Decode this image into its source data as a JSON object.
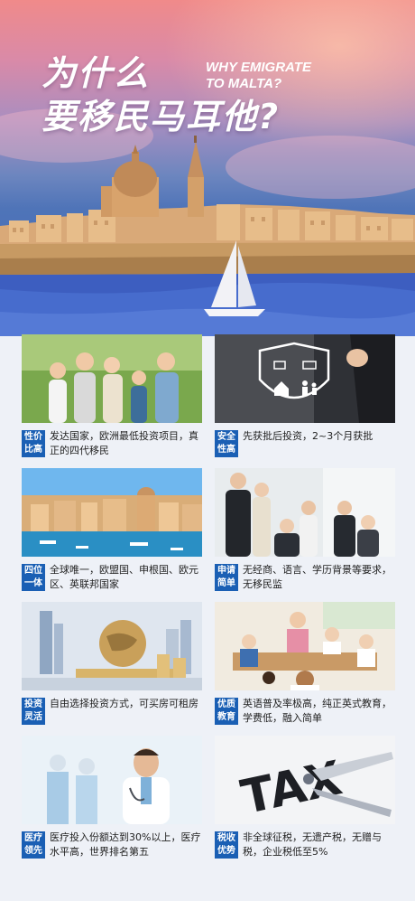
{
  "hero": {
    "title_line1": "为什么",
    "title_line2": "要移民马耳他?",
    "en_line1": "WHY EMIGRATE",
    "en_line2": "TO MALTA?"
  },
  "cards": [
    {
      "tag": [
        "性价",
        "比高"
      ],
      "text": "发达国家，欧洲最低投资项目，真正的四代移民",
      "photo": "family-photo"
    },
    {
      "tag": [
        "安全",
        "性高"
      ],
      "text": "先获批后投资，2~3个月获批",
      "photo": "security-shield-photo"
    },
    {
      "tag": [
        "四位",
        "一体"
      ],
      "text": "全球唯一，欧盟国、申根国、欧元区、英联邦国家",
      "photo": "malta-harbor-photo"
    },
    {
      "tag": [
        "申请",
        "简单"
      ],
      "text": "无经商、语言、学历背景等要求，无移民监",
      "photo": "business-team-photo"
    },
    {
      "tag": [
        "投资",
        "灵活"
      ],
      "text": "自由选择投资方式，可买房可租房",
      "photo": "globe-coins-photo"
    },
    {
      "tag": [
        "优质",
        "教育"
      ],
      "text": "英语普及率极高，纯正英式教育，学费低，融入简单",
      "photo": "classroom-photo"
    },
    {
      "tag": [
        "医疗",
        "领先"
      ],
      "text": "医疗投入份额达到30%以上，医疗水平高，世界排名第五",
      "photo": "doctor-photo"
    },
    {
      "tag": [
        "税收",
        "优势"
      ],
      "text": "非全球征税，无遗产税，无赠与税，企业税低至5%",
      "photo": "tax-scissors-photo"
    }
  ]
}
